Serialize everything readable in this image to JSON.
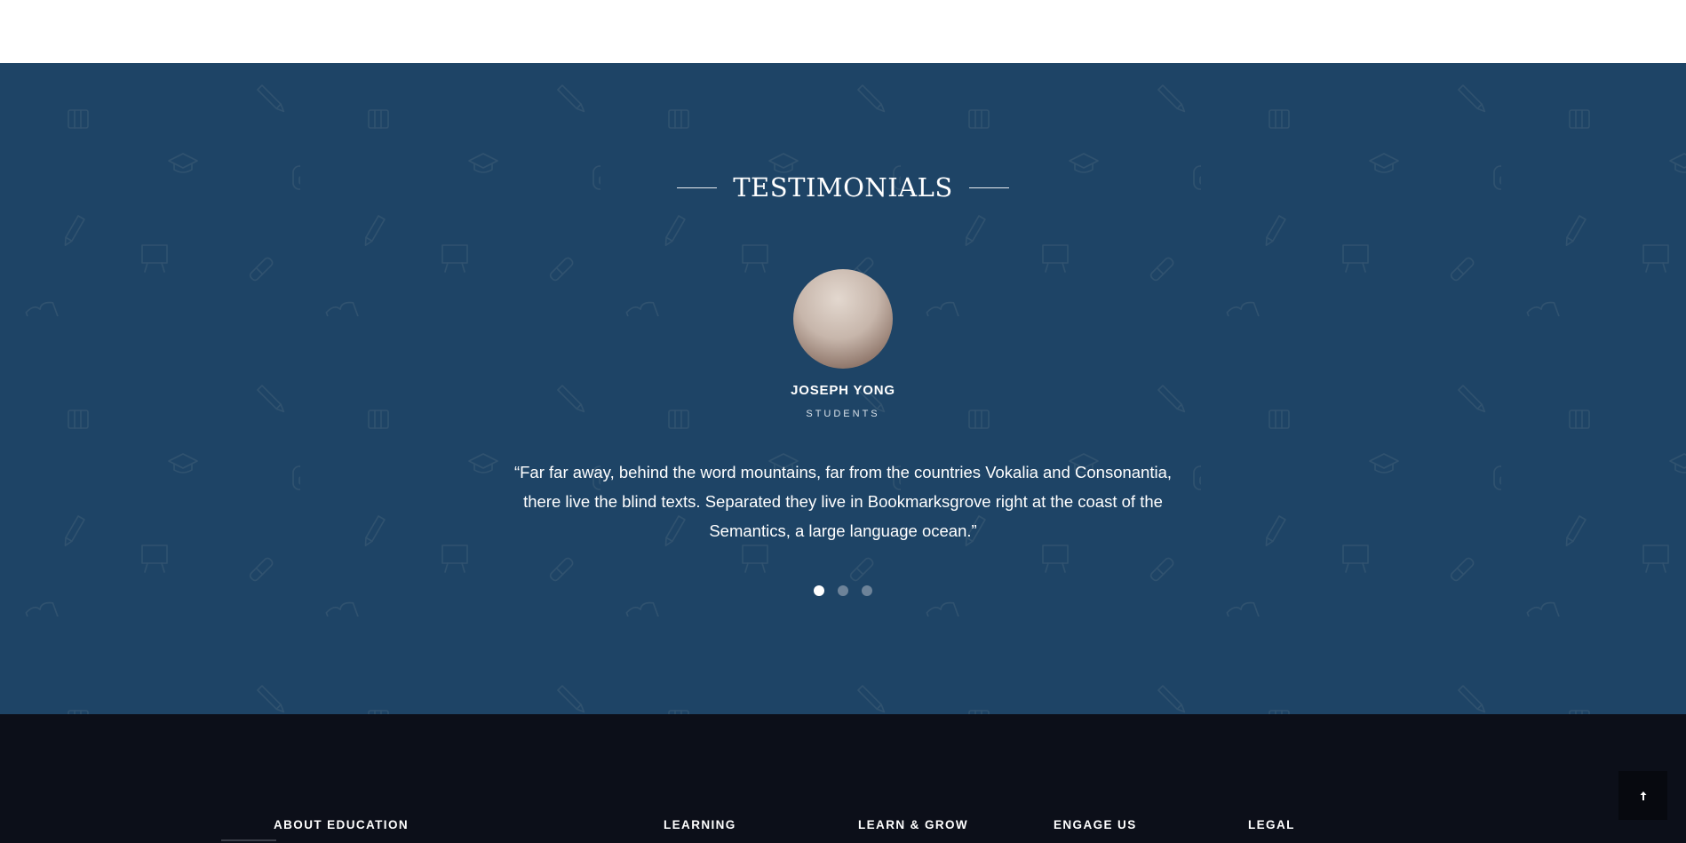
{
  "testimonials": {
    "heading": "TESTIMONIALS",
    "name": "JOSEPH YONG",
    "role": "STUDENTS",
    "quote": "“Far far away, behind the word mountains, far from the countries Vokalia and Consonantia, there live the blind texts. Separated they live in Bookmarksgrove right at the coast of the Semantics, a large language ocean.”",
    "slide_count": 3,
    "active_slide": 1
  },
  "footer": {
    "columns": [
      "ABOUT EDUCATION",
      "LEARNING",
      "LEARN & GROW",
      "ENGAGE US",
      "LEGAL"
    ]
  },
  "back_to_top": {
    "icon": "arrow-up-icon",
    "glyph": "🠕"
  },
  "colors": {
    "section_bg": "#1e4466",
    "footer_bg": "#0c0f19",
    "dot_active": "#ffffff",
    "dot_inactive": "#6d8399"
  }
}
